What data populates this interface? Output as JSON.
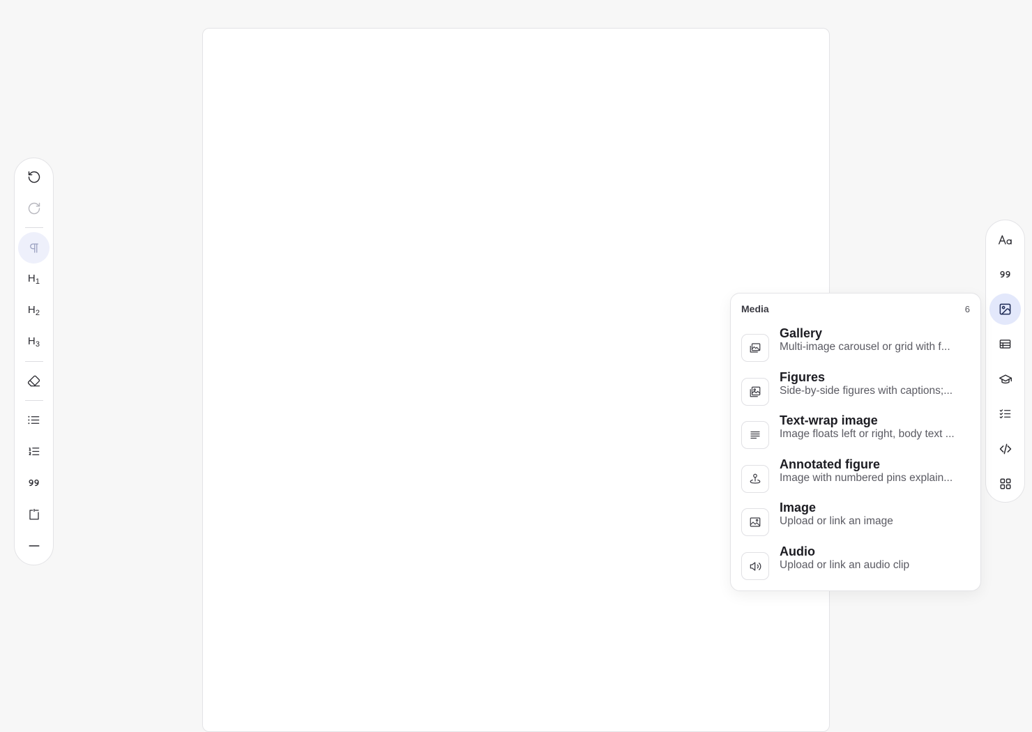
{
  "left_toolbar": {
    "items": [
      {
        "name": "undo",
        "icon": "undo-icon"
      },
      {
        "name": "redo",
        "icon": "redo-icon"
      },
      {
        "name": "paragraph",
        "icon": "paragraph-icon"
      },
      {
        "name": "heading-1",
        "label": "H",
        "sub": "1"
      },
      {
        "name": "heading-2",
        "label": "H",
        "sub": "2"
      },
      {
        "name": "heading-3",
        "label": "H",
        "sub": "3"
      },
      {
        "name": "clear-format",
        "icon": "eraser-icon"
      },
      {
        "name": "bullet-list",
        "icon": "bullet-list-icon"
      },
      {
        "name": "numbered-list",
        "icon": "numbered-list-icon"
      },
      {
        "name": "quote",
        "icon": "quote-icon"
      },
      {
        "name": "callout",
        "icon": "callout-icon"
      },
      {
        "name": "divider",
        "icon": "horizontal-rule-icon"
      }
    ]
  },
  "right_toolbar": {
    "items": [
      {
        "name": "typography",
        "icon": "typography-icon"
      },
      {
        "name": "quotes",
        "icon": "quote-icon"
      },
      {
        "name": "media",
        "icon": "image-icon",
        "active": true
      },
      {
        "name": "table",
        "icon": "table-icon"
      },
      {
        "name": "education",
        "icon": "graduation-cap-icon"
      },
      {
        "name": "checklist",
        "icon": "checklist-icon"
      },
      {
        "name": "code",
        "icon": "code-icon"
      },
      {
        "name": "more",
        "icon": "grid-icon"
      }
    ]
  },
  "media_popover": {
    "title": "Media",
    "count": "6",
    "items": [
      {
        "title": "Gallery",
        "description": "Multi-image carousel or grid with f...",
        "icon": "gallery-icon"
      },
      {
        "title": "Figures",
        "description": "Side-by-side figures with captions;...",
        "icon": "figures-icon"
      },
      {
        "title": "Text-wrap image",
        "description": "Image floats left or right, body text ...",
        "icon": "text-wrap-icon"
      },
      {
        "title": "Annotated figure",
        "description": "Image with numbered pins explain...",
        "icon": "pin-icon"
      },
      {
        "title": "Image",
        "description": "Upload or link an image",
        "icon": "image-icon"
      },
      {
        "title": "Audio",
        "description": "Upload or link an audio clip",
        "icon": "audio-icon"
      }
    ]
  },
  "colors": {
    "accent_active_bg": "#e3e8fb",
    "accent_active_fg": "#1e2a55",
    "border": "#e3e3e6",
    "background": "#f7f7f7"
  }
}
